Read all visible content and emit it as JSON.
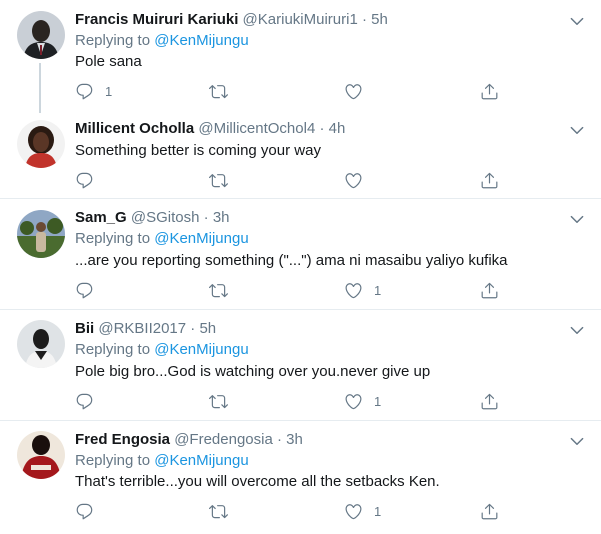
{
  "tweets": [
    {
      "name": "Francis Muiruri Kariuki",
      "handle": "@KariukiMuiruri1",
      "time": "5h",
      "replying_prefix": "Replying to",
      "replying_to": "@KenMijungu",
      "text": "Pole sana",
      "reply_count": "1",
      "retweet_count": "",
      "like_count": "",
      "avatar_colors": [
        "#c9cfd6",
        "#1e2124",
        "#d9dde0"
      ]
    },
    {
      "name": "Millicent Ocholla",
      "handle": "@MillicentOchol4",
      "time": "4h",
      "replying_prefix": "",
      "replying_to": "",
      "text": "Something better is coming your way",
      "reply_count": "",
      "retweet_count": "",
      "like_count": "",
      "avatar_colors": [
        "#f2f2f2",
        "#3b2418",
        "#c1332b"
      ]
    },
    {
      "name": "Sam_G",
      "handle": "@SGitosh",
      "time": "3h",
      "replying_prefix": "Replying to",
      "replying_to": "@KenMijungu",
      "text": "...are you reporting something (\"...\") ama ni masaibu yaliyo kufika",
      "reply_count": "",
      "retweet_count": "",
      "like_count": "1",
      "avatar_colors": [
        "#8fa7c4",
        "#4a6b2f",
        "#6b4a32"
      ]
    },
    {
      "name": "Bii",
      "handle": "@RKBII2017",
      "time": "5h",
      "replying_prefix": "Replying to",
      "replying_to": "@KenMijungu",
      "text": "Pole big bro...God is watching over you.never give up",
      "reply_count": "",
      "retweet_count": "",
      "like_count": "1",
      "avatar_colors": [
        "#dfe3e6",
        "#1c1c1c",
        "#f4f4f4"
      ]
    },
    {
      "name": "Fred Engosia",
      "handle": "@Fredengosia",
      "time": "3h",
      "replying_prefix": "Replying to",
      "replying_to": "@KenMijungu",
      "text": "That's terrible...you will overcome all the setbacks  Ken.",
      "reply_count": "",
      "retweet_count": "",
      "like_count": "1",
      "avatar_colors": [
        "#a4181c",
        "#1a0f0d",
        "#efe7dc"
      ]
    }
  ],
  "dot": "·",
  "colors": {
    "link": "#1b95e0",
    "secondary": "#657786",
    "border": "#e6ecf0"
  },
  "icons": {
    "reply": "reply-icon",
    "retweet": "retweet-icon",
    "like": "heart-icon",
    "share": "share-icon",
    "more": "chevron-down-icon"
  }
}
